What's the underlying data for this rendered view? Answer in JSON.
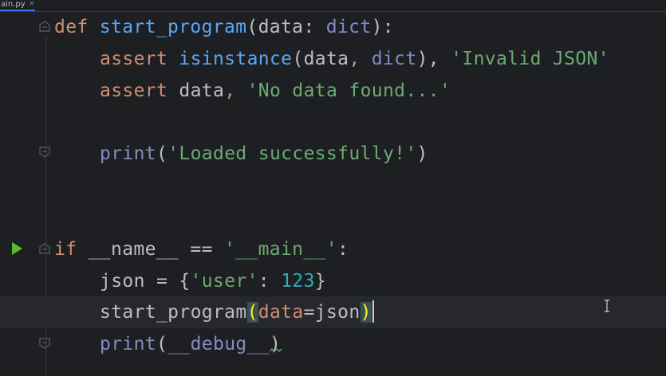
{
  "tab": {
    "filename": "ain.py",
    "close_glyph": "×"
  },
  "code": {
    "l1": {
      "kw_def": "def",
      "fn_name": "start_program",
      "p_open": "(",
      "param": "data",
      "colon": ":",
      "type": "dict",
      "p_close": "):"
    },
    "l2": {
      "kw": "assert",
      "fn": "isinstance",
      "p_open": "(",
      "arg": "data",
      "comma": ",",
      "type": "dict",
      "p_close": "),",
      "str": "'Invalid JSON'"
    },
    "l3": {
      "kw": "assert",
      "arg": "data",
      "comma": ",",
      "str": "'No data found...'"
    },
    "l4": {
      "fn": "print",
      "p_open": "(",
      "str": "'Loaded successfully!'",
      "p_close": ")"
    },
    "l5": {
      "kw_if": "if",
      "dunder": "__name__",
      "op": "==",
      "str": "'__main__'",
      "colon": ":"
    },
    "l6": {
      "var": "json",
      "eq": "=",
      "brace_open": "{",
      "key": "'user'",
      "colon": ":",
      "num": "123",
      "brace_close": "}"
    },
    "l7": {
      "fn": "start_program",
      "p_open": "(",
      "kwarg": "data",
      "eq": "=",
      "val": "json",
      "p_close": ")"
    },
    "l8": {
      "fn": "print",
      "p_open": "(",
      "dunder": "__debug__",
      "p_close": ")"
    }
  },
  "icons": {
    "run": "run-arrow-icon",
    "fold": "fold-marker-icon",
    "cursor": "text-cursor-icon",
    "warning": "warning-squiggle-icon"
  },
  "colors": {
    "background": "#1e1f22",
    "keyword": "#cf8e6d",
    "function": "#56a8f5",
    "builtin_type": "#8888c6",
    "string": "#6aab73",
    "number": "#2aacb8",
    "run_icon": "#5fb832"
  }
}
